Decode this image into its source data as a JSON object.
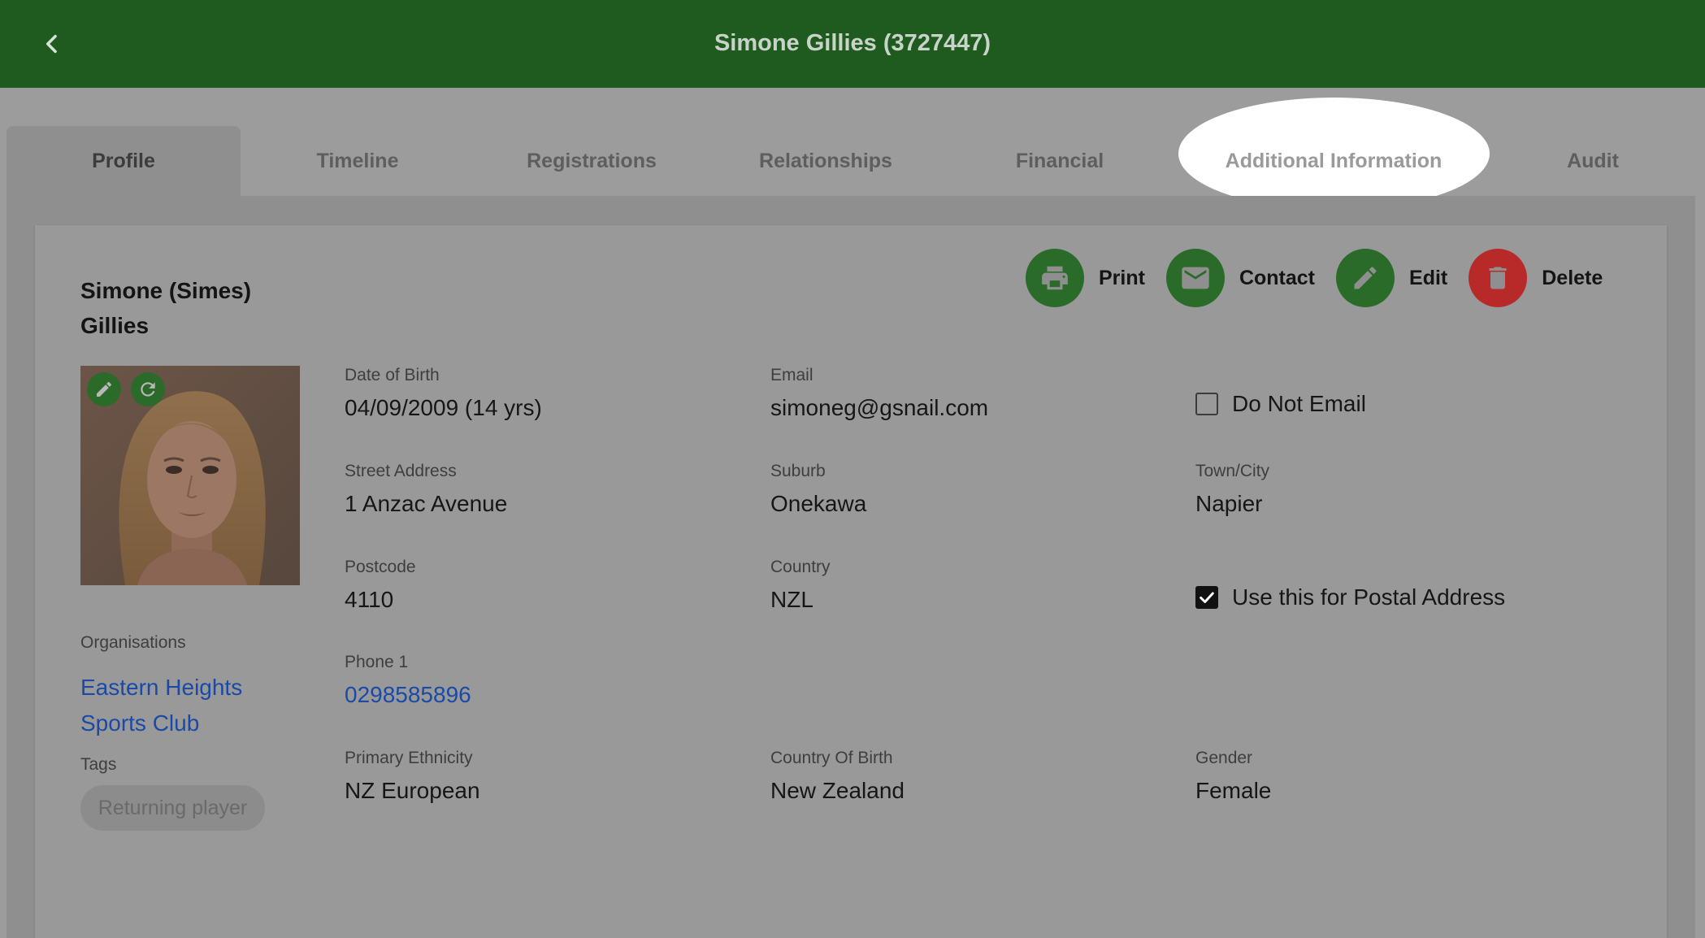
{
  "header": {
    "title": "Simone Gillies (3727447)",
    "background": "#1f5b1f"
  },
  "tabs": [
    {
      "label": "Profile",
      "active": true
    },
    {
      "label": "Timeline"
    },
    {
      "label": "Registrations"
    },
    {
      "label": "Relationships"
    },
    {
      "label": "Financial"
    },
    {
      "label": "Additional Information",
      "highlighted": true
    },
    {
      "label": "Audit"
    }
  ],
  "member": {
    "name_line1": "Simone (Simes)",
    "name_line2": "Gillies"
  },
  "actions": {
    "print": {
      "label": "Print",
      "icon": "printer-icon",
      "color": "#2a6b2a"
    },
    "contact": {
      "label": "Contact",
      "icon": "envelope-icon",
      "color": "#2a6b2a"
    },
    "edit": {
      "label": "Edit",
      "icon": "pencil-icon",
      "color": "#2a6b2a"
    },
    "delete": {
      "label": "Delete",
      "icon": "trash-icon",
      "color": "#b82a2a"
    }
  },
  "photo": {
    "edit_icon": "pencil-icon",
    "rotate_icon": "rotate-icon"
  },
  "fields": {
    "dob": {
      "label": "Date of Birth",
      "value": "04/09/2009 (14 yrs)"
    },
    "email": {
      "label": "Email",
      "value": "simoneg@gsnail.com"
    },
    "street": {
      "label": "Street Address",
      "value": "1 Anzac Avenue"
    },
    "suburb": {
      "label": "Suburb",
      "value": "Onekawa"
    },
    "town": {
      "label": "Town/City",
      "value": "Napier"
    },
    "postcode": {
      "label": "Postcode",
      "value": "4110"
    },
    "country": {
      "label": "Country",
      "value": "NZL"
    },
    "phone1": {
      "label": "Phone 1",
      "value": "0298585896"
    },
    "ethnicity": {
      "label": "Primary Ethnicity",
      "value": "NZ European"
    },
    "country_of_birth": {
      "label": "Country Of Birth",
      "value": "New Zealand"
    },
    "gender": {
      "label": "Gender",
      "value": "Female"
    }
  },
  "checkboxes": {
    "do_not_email": {
      "label": "Do Not Email",
      "checked": false
    },
    "postal_address": {
      "label": "Use this for Postal Address",
      "checked": true
    }
  },
  "organisations": {
    "label": "Organisations",
    "line1": "Eastern Heights",
    "line2": "Sports Club"
  },
  "tags": {
    "label": "Tags",
    "items": [
      "Returning player"
    ]
  }
}
